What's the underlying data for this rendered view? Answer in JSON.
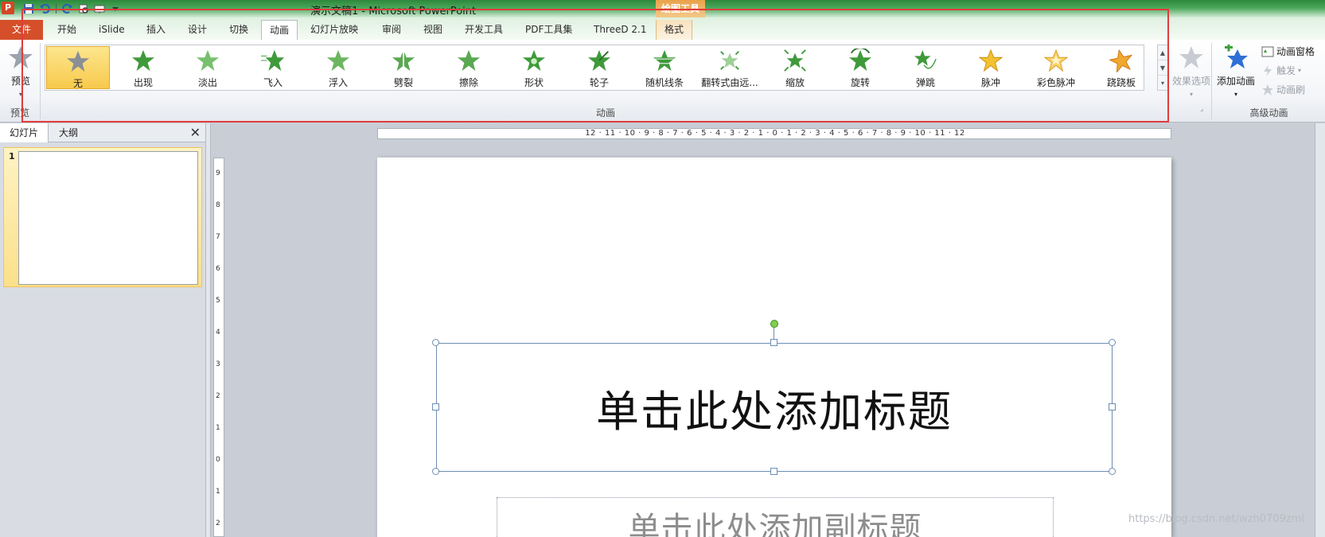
{
  "title_bar": {
    "app_icon_letter": "P",
    "window_title": "演示文稿1 - Microsoft PowerPoint",
    "context_tab_group": "绘图工具"
  },
  "tabs": [
    {
      "label": "文件",
      "kind": "file"
    },
    {
      "label": "开始"
    },
    {
      "label": "iSlide"
    },
    {
      "label": "插入"
    },
    {
      "label": "设计"
    },
    {
      "label": "切换"
    },
    {
      "label": "动画",
      "active": true
    },
    {
      "label": "幻灯片放映"
    },
    {
      "label": "审阅"
    },
    {
      "label": "视图"
    },
    {
      "label": "开发工具"
    },
    {
      "label": "PDF工具集"
    },
    {
      "label": "ThreeD 2.1"
    },
    {
      "label": "格式",
      "context": true
    }
  ],
  "ribbon": {
    "preview": {
      "button_label": "预览",
      "group_label": "预览"
    },
    "animation_gallery": {
      "group_label": "动画",
      "items": [
        {
          "label": "无",
          "icon": "star-none-icon",
          "selected": true
        },
        {
          "label": "出现",
          "icon": "star-appear-icon"
        },
        {
          "label": "淡出",
          "icon": "star-fade-icon"
        },
        {
          "label": "飞入",
          "icon": "star-fly-in-icon"
        },
        {
          "label": "浮入",
          "icon": "star-float-in-icon"
        },
        {
          "label": "劈裂",
          "icon": "star-split-icon"
        },
        {
          "label": "擦除",
          "icon": "star-wipe-icon"
        },
        {
          "label": "形状",
          "icon": "star-shape-icon"
        },
        {
          "label": "轮子",
          "icon": "star-wheel-icon"
        },
        {
          "label": "随机线条",
          "icon": "star-random-bars-icon"
        },
        {
          "label": "翻转式由远...",
          "icon": "star-grow-turn-icon"
        },
        {
          "label": "缩放",
          "icon": "star-zoom-icon"
        },
        {
          "label": "旋转",
          "icon": "star-swivel-icon"
        },
        {
          "label": "弹跳",
          "icon": "star-bounce-icon"
        },
        {
          "label": "脉冲",
          "icon": "star-pulse-icon"
        },
        {
          "label": "彩色脉冲",
          "icon": "star-color-pulse-icon"
        },
        {
          "label": "跷跷板",
          "icon": "star-teeter-icon"
        }
      ]
    },
    "effect_options": {
      "label": "效果选项",
      "disabled": true
    },
    "advanced": {
      "group_label": "高级动画",
      "add_animation": "添加动画",
      "animation_pane": "动画窗格",
      "trigger": "触发",
      "animation_painter": "动画刷"
    }
  },
  "left_pane": {
    "tab_slides": "幻灯片",
    "tab_outline": "大纲",
    "close_glyph": "✕",
    "slide_number": "1"
  },
  "ruler": {
    "h_labels": "12 · 11 · 10 · 9 · 8 · 7 · 6 · 5 · 4 · 3 · 2 · 1 · 0 · 1 · 2 · 3 · 4 · 5 · 6 · 7 · 8 · 9 · 10 · 11 · 12",
    "v_labels": [
      "9",
      "8",
      "7",
      "6",
      "5",
      "4",
      "3",
      "2",
      "1",
      "0",
      "1",
      "2"
    ]
  },
  "slide": {
    "title_placeholder": "单击此处添加标题",
    "subtitle_placeholder": "单击此处添加副标题"
  },
  "watermark": "https://blog.csdn.net/wzh0709zml",
  "colors": {
    "accent_green": "#4aa65a",
    "file_tab": "#d54f2a",
    "selection_gold": "#f7c94c",
    "highlight_red": "#e03c3c"
  }
}
